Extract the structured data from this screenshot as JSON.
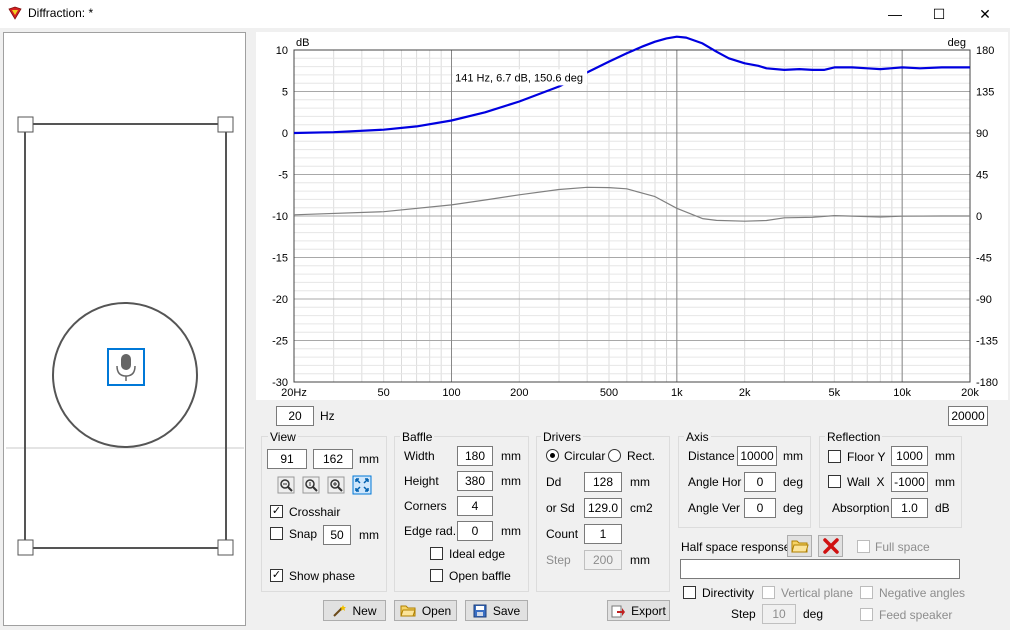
{
  "window": {
    "title": "Diffraction: *",
    "minimize": "—",
    "maximize": "☐",
    "close": "✕"
  },
  "chart_data": {
    "type": "line",
    "x_scale": "log",
    "xlim": [
      20,
      20000
    ],
    "ylim_left": [
      -30,
      10
    ],
    "ylim_right": [
      -180,
      180
    ],
    "left_unit": "dB",
    "right_unit": "deg",
    "x_ticks": [
      {
        "v": 20,
        "label": "20Hz"
      },
      {
        "v": 50,
        "label": "50"
      },
      {
        "v": 100,
        "label": "100"
      },
      {
        "v": 200,
        "label": "200"
      },
      {
        "v": 500,
        "label": "500"
      },
      {
        "v": 1000,
        "label": "1k"
      },
      {
        "v": 2000,
        "label": "2k"
      },
      {
        "v": 5000,
        "label": "5k"
      },
      {
        "v": 10000,
        "label": "10k"
      },
      {
        "v": 20000,
        "label": "20k"
      }
    ],
    "left_ticks": [
      "10",
      "5",
      "0",
      "-5",
      "-10",
      "-15",
      "-20",
      "-25",
      "-30"
    ],
    "right_ticks": [
      "180",
      "135",
      "90",
      "45",
      "0",
      "-45",
      "-90",
      "-135",
      "-180"
    ],
    "grid": true,
    "cursor_readout": "141 Hz, 6.7 dB, 150.6 deg",
    "cursor_x": 141,
    "cursor_y": 6.7,
    "series": [
      {
        "color": "#0000e0",
        "axis": "left",
        "x": [
          20,
          30,
          50,
          70,
          100,
          141,
          200,
          300,
          400,
          500,
          600,
          700,
          800,
          900,
          1000,
          1100,
          1300,
          1500,
          1700,
          2000,
          2300,
          2500,
          3000,
          3500,
          4000,
          4500,
          5000,
          6000,
          7000,
          8000,
          10000,
          12000,
          15000,
          20000
        ],
        "values": [
          0.0,
          0.1,
          0.4,
          0.8,
          1.5,
          2.5,
          3.8,
          5.6,
          7.3,
          8.6,
          9.6,
          10.4,
          11.0,
          11.4,
          11.6,
          11.5,
          10.8,
          9.8,
          9.0,
          8.4,
          8.1,
          7.8,
          7.6,
          7.7,
          7.6,
          7.6,
          7.9,
          7.9,
          7.8,
          7.7,
          7.9,
          7.8,
          7.9,
          7.9
        ]
      },
      {
        "color": "#808080",
        "axis": "right",
        "x": [
          20,
          50,
          100,
          141,
          200,
          300,
          400,
          500,
          600,
          800,
          1000,
          1300,
          1500,
          2000,
          2500,
          3000,
          4000,
          5000,
          6000,
          8000,
          10000,
          15000,
          20000
        ],
        "values": [
          1.3,
          4.7,
          12.0,
          17.3,
          23.0,
          28.7,
          31.1,
          30.8,
          29.5,
          21.0,
          8.4,
          -2.8,
          -4.8,
          -5.6,
          -4.9,
          -1.9,
          -1.4,
          0.4,
          -0.1,
          -1.1,
          -0.2,
          0.0,
          0.0
        ]
      }
    ]
  },
  "freq": {
    "min": "20",
    "min_unit": "Hz",
    "max": "20000"
  },
  "view": {
    "title": "View",
    "x": "91",
    "y": "162",
    "unit": "mm",
    "crosshair_label": "Crosshair",
    "crosshair_checked": true,
    "snap_label": "Snap",
    "snap_value": "50",
    "snap_unit": "mm",
    "snap_checked": false,
    "show_phase_label": "Show phase",
    "show_phase_checked": true
  },
  "baffle": {
    "title": "Baffle",
    "width_label": "Width",
    "width": "180",
    "width_unit": "mm",
    "height_label": "Height",
    "height": "380",
    "height_unit": "mm",
    "corners_label": "Corners",
    "corners": "4",
    "edge_label": "Edge rad.",
    "edge": "0",
    "edge_unit": "mm",
    "ideal_edge_label": "Ideal edge",
    "open_baffle_label": "Open baffle"
  },
  "drivers": {
    "title": "Drivers",
    "circular_label": "Circular",
    "rect_label": "Rect.",
    "dd_label": "Dd",
    "dd": "128",
    "dd_unit": "mm",
    "sd_label": "or Sd",
    "sd": "129.0",
    "sd_unit": "cm2",
    "count_label": "Count",
    "count": "1",
    "step_label": "Step",
    "step": "200",
    "step_unit": "mm"
  },
  "axis": {
    "title": "Axis",
    "distance_label": "Distance",
    "distance": "10000",
    "distance_unit": "mm",
    "hor_label": "Angle Hor",
    "hor": "0",
    "hor_unit": "deg",
    "ver_label": "Angle Ver",
    "ver": "0",
    "ver_unit": "deg"
  },
  "reflection": {
    "title": "Reflection",
    "floor_label": "Floor Y",
    "floor": "1000",
    "floor_unit": "mm",
    "wall_label": "Wall  X",
    "wall": "-1000",
    "wall_unit": "mm",
    "absorption_label": "Absorption",
    "absorption": "1.0",
    "absorption_unit": "dB"
  },
  "half_space": {
    "label": "Half space response",
    "full_space_label": "Full space",
    "path": "",
    "directivity_label": "Directivity",
    "vertical_plane_label": "Vertical plane",
    "negative_angles_label": "Negative angles",
    "feed_speaker_label": "Feed speaker",
    "step_label": "Step",
    "step": "10",
    "step_unit": "deg"
  },
  "buttons": {
    "new": "New",
    "open": "Open",
    "save": "Save",
    "export": "Export"
  },
  "colors": {
    "accent_blue": "#0078d7",
    "curve_blue": "#0000e0",
    "curve_gray": "#808080",
    "delete_red": "#d01010"
  }
}
